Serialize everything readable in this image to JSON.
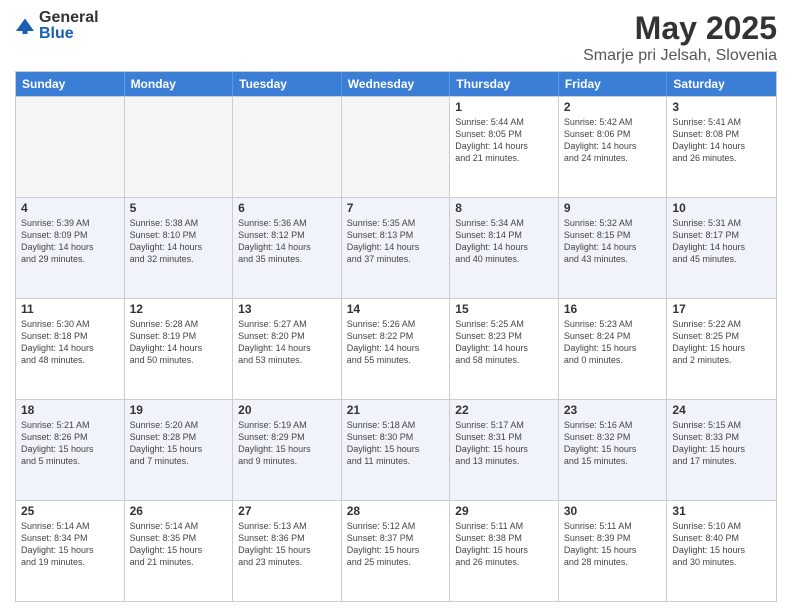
{
  "logo": {
    "general": "General",
    "blue": "Blue"
  },
  "title": {
    "month_year": "May 2025",
    "location": "Smarje pri Jelsah, Slovenia"
  },
  "header_days": [
    "Sunday",
    "Monday",
    "Tuesday",
    "Wednesday",
    "Thursday",
    "Friday",
    "Saturday"
  ],
  "rows": [
    [
      {
        "day": "",
        "info": ""
      },
      {
        "day": "",
        "info": ""
      },
      {
        "day": "",
        "info": ""
      },
      {
        "day": "",
        "info": ""
      },
      {
        "day": "1",
        "info": "Sunrise: 5:44 AM\nSunset: 8:05 PM\nDaylight: 14 hours\nand 21 minutes."
      },
      {
        "day": "2",
        "info": "Sunrise: 5:42 AM\nSunset: 8:06 PM\nDaylight: 14 hours\nand 24 minutes."
      },
      {
        "day": "3",
        "info": "Sunrise: 5:41 AM\nSunset: 8:08 PM\nDaylight: 14 hours\nand 26 minutes."
      }
    ],
    [
      {
        "day": "4",
        "info": "Sunrise: 5:39 AM\nSunset: 8:09 PM\nDaylight: 14 hours\nand 29 minutes."
      },
      {
        "day": "5",
        "info": "Sunrise: 5:38 AM\nSunset: 8:10 PM\nDaylight: 14 hours\nand 32 minutes."
      },
      {
        "day": "6",
        "info": "Sunrise: 5:36 AM\nSunset: 8:12 PM\nDaylight: 14 hours\nand 35 minutes."
      },
      {
        "day": "7",
        "info": "Sunrise: 5:35 AM\nSunset: 8:13 PM\nDaylight: 14 hours\nand 37 minutes."
      },
      {
        "day": "8",
        "info": "Sunrise: 5:34 AM\nSunset: 8:14 PM\nDaylight: 14 hours\nand 40 minutes."
      },
      {
        "day": "9",
        "info": "Sunrise: 5:32 AM\nSunset: 8:15 PM\nDaylight: 14 hours\nand 43 minutes."
      },
      {
        "day": "10",
        "info": "Sunrise: 5:31 AM\nSunset: 8:17 PM\nDaylight: 14 hours\nand 45 minutes."
      }
    ],
    [
      {
        "day": "11",
        "info": "Sunrise: 5:30 AM\nSunset: 8:18 PM\nDaylight: 14 hours\nand 48 minutes."
      },
      {
        "day": "12",
        "info": "Sunrise: 5:28 AM\nSunset: 8:19 PM\nDaylight: 14 hours\nand 50 minutes."
      },
      {
        "day": "13",
        "info": "Sunrise: 5:27 AM\nSunset: 8:20 PM\nDaylight: 14 hours\nand 53 minutes."
      },
      {
        "day": "14",
        "info": "Sunrise: 5:26 AM\nSunset: 8:22 PM\nDaylight: 14 hours\nand 55 minutes."
      },
      {
        "day": "15",
        "info": "Sunrise: 5:25 AM\nSunset: 8:23 PM\nDaylight: 14 hours\nand 58 minutes."
      },
      {
        "day": "16",
        "info": "Sunrise: 5:23 AM\nSunset: 8:24 PM\nDaylight: 15 hours\nand 0 minutes."
      },
      {
        "day": "17",
        "info": "Sunrise: 5:22 AM\nSunset: 8:25 PM\nDaylight: 15 hours\nand 2 minutes."
      }
    ],
    [
      {
        "day": "18",
        "info": "Sunrise: 5:21 AM\nSunset: 8:26 PM\nDaylight: 15 hours\nand 5 minutes."
      },
      {
        "day": "19",
        "info": "Sunrise: 5:20 AM\nSunset: 8:28 PM\nDaylight: 15 hours\nand 7 minutes."
      },
      {
        "day": "20",
        "info": "Sunrise: 5:19 AM\nSunset: 8:29 PM\nDaylight: 15 hours\nand 9 minutes."
      },
      {
        "day": "21",
        "info": "Sunrise: 5:18 AM\nSunset: 8:30 PM\nDaylight: 15 hours\nand 11 minutes."
      },
      {
        "day": "22",
        "info": "Sunrise: 5:17 AM\nSunset: 8:31 PM\nDaylight: 15 hours\nand 13 minutes."
      },
      {
        "day": "23",
        "info": "Sunrise: 5:16 AM\nSunset: 8:32 PM\nDaylight: 15 hours\nand 15 minutes."
      },
      {
        "day": "24",
        "info": "Sunrise: 5:15 AM\nSunset: 8:33 PM\nDaylight: 15 hours\nand 17 minutes."
      }
    ],
    [
      {
        "day": "25",
        "info": "Sunrise: 5:14 AM\nSunset: 8:34 PM\nDaylight: 15 hours\nand 19 minutes."
      },
      {
        "day": "26",
        "info": "Sunrise: 5:14 AM\nSunset: 8:35 PM\nDaylight: 15 hours\nand 21 minutes."
      },
      {
        "day": "27",
        "info": "Sunrise: 5:13 AM\nSunset: 8:36 PM\nDaylight: 15 hours\nand 23 minutes."
      },
      {
        "day": "28",
        "info": "Sunrise: 5:12 AM\nSunset: 8:37 PM\nDaylight: 15 hours\nand 25 minutes."
      },
      {
        "day": "29",
        "info": "Sunrise: 5:11 AM\nSunset: 8:38 PM\nDaylight: 15 hours\nand 26 minutes."
      },
      {
        "day": "30",
        "info": "Sunrise: 5:11 AM\nSunset: 8:39 PM\nDaylight: 15 hours\nand 28 minutes."
      },
      {
        "day": "31",
        "info": "Sunrise: 5:10 AM\nSunset: 8:40 PM\nDaylight: 15 hours\nand 30 minutes."
      }
    ]
  ]
}
